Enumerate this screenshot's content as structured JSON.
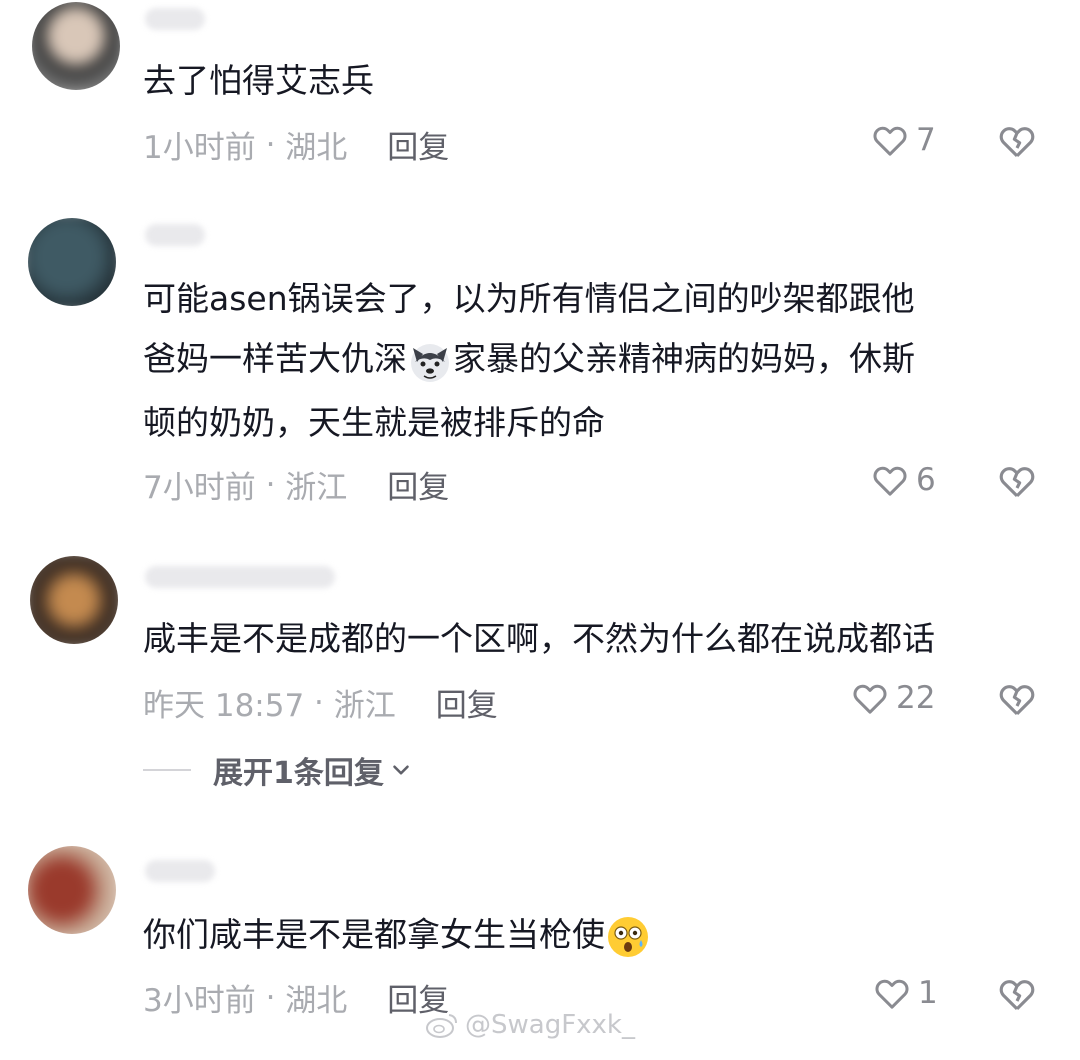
{
  "comments": [
    {
      "text_lines": [
        "去了怕得艾志兵"
      ],
      "time": "1小时前",
      "location": "湖北",
      "reply_label": "回复",
      "likes": "7"
    },
    {
      "text_lines": [
        "可能asen锅误会了，以为所有情侣之间的吵架都跟他",
        "爸妈一样苦大仇深",
        "家暴的父亲精神病的妈妈，休斯",
        "顿的奶奶，天生就是被排斥的命"
      ],
      "time": "7小时前",
      "location": "浙江",
      "reply_label": "回复",
      "likes": "6",
      "emoji_name": "wolf-emoji"
    },
    {
      "text_lines": [
        "咸丰是不是成都的一个区啊，不然为什么都在说成都话"
      ],
      "time": "昨天 18:57",
      "location": "浙江",
      "reply_label": "回复",
      "likes": "22",
      "expand_label": "展开1条回复"
    },
    {
      "text_lines": [
        "你们咸丰是不是都拿女生当枪使"
      ],
      "time": "3小时前",
      "location": "湖北",
      "reply_label": "回复",
      "likes": "1",
      "emoji_name": "shocked-emoji"
    }
  ],
  "watermark": "@SwagFxxk_",
  "colors": {
    "text": "#161823",
    "meta": "#a9abb0",
    "reply": "#5f6069",
    "icon": "#8a8b91"
  }
}
